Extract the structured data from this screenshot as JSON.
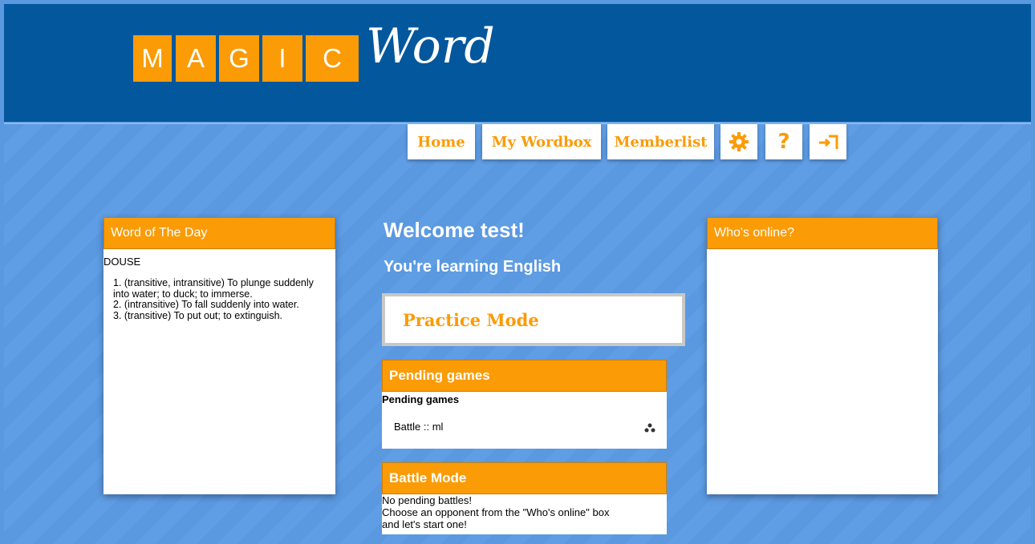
{
  "logo": {
    "letters": [
      "M",
      "A",
      "G",
      "I",
      "C"
    ],
    "word": "Word"
  },
  "nav": {
    "home": "Home",
    "wordbox": "My Wordbox",
    "memberlist": "Memberlist",
    "help": "?"
  },
  "word_of_day": {
    "title": "Word of The Day",
    "word": "DOUSE",
    "definitions": [
      "1. (transitive, intransitive) To plunge suddenly into water; to duck; to immerse.",
      "2. (intransitive) To fall suddenly into water.",
      "3. (transitive) To put out; to extinguish."
    ]
  },
  "welcome": {
    "title": "Welcome test!",
    "subtitle": "You're learning English"
  },
  "practice": {
    "label": "Practice Mode"
  },
  "pending": {
    "header": "Pending games",
    "label": "Pending games",
    "item": "Battle :: ml"
  },
  "battle": {
    "header": "Battle Mode",
    "line1": "No pending battles!",
    "line2": "Choose an opponent from the \"Who's online\" box",
    "line3": "and let's start one!"
  },
  "online": {
    "title": "Who's online?"
  },
  "colors": {
    "accent": "#fb9b06",
    "header_bg": "#03579c",
    "page_bg": "#5a98e0"
  },
  "icons": {
    "settings": "gear-icon",
    "logout": "logout-icon",
    "players": "players-icon"
  }
}
